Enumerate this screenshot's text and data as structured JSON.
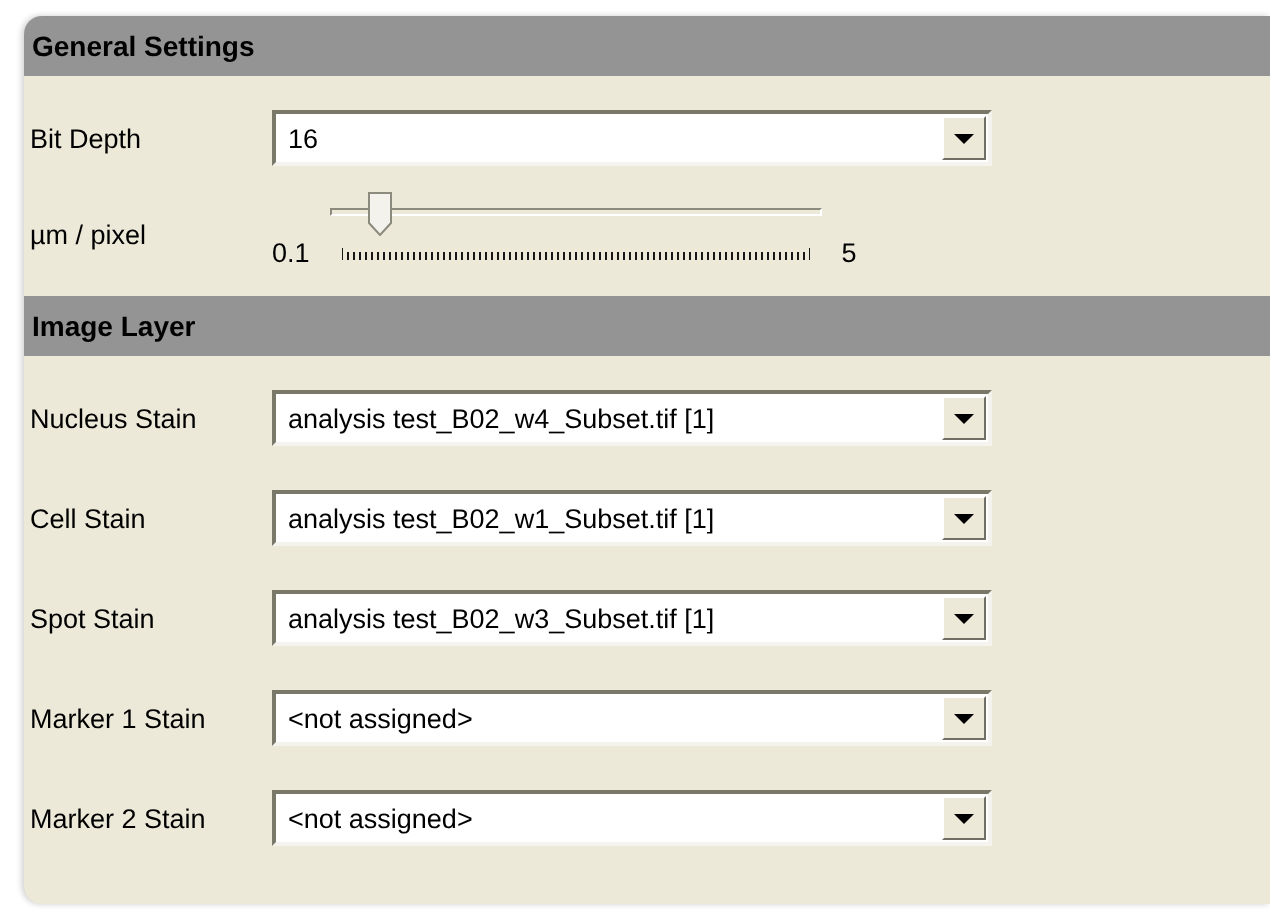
{
  "sections": [
    {
      "title": "General Settings",
      "rows": [
        {
          "kind": "dropdown",
          "label": "Bit Depth",
          "value": "16"
        },
        {
          "kind": "slider",
          "label": "µm / pixel",
          "min_label": "0.1",
          "max_label": "5",
          "level": 0.1
        }
      ]
    },
    {
      "title": "Image Layer",
      "rows": [
        {
          "kind": "dropdown",
          "label": "Nucleus Stain",
          "value": "analysis test_B02_w4_Subset.tif [1]"
        },
        {
          "kind": "dropdown",
          "label": "Cell Stain",
          "value": "analysis test_B02_w1_Subset.tif [1]"
        },
        {
          "kind": "dropdown",
          "label": "Spot Stain",
          "value": "analysis test_B02_w3_Subset.tif [1]"
        },
        {
          "kind": "dropdown",
          "label": "Marker 1 Stain",
          "value": "<not assigned>"
        },
        {
          "kind": "dropdown",
          "label": "Marker 2 Stain",
          "value": "<not assigned>"
        }
      ]
    }
  ]
}
